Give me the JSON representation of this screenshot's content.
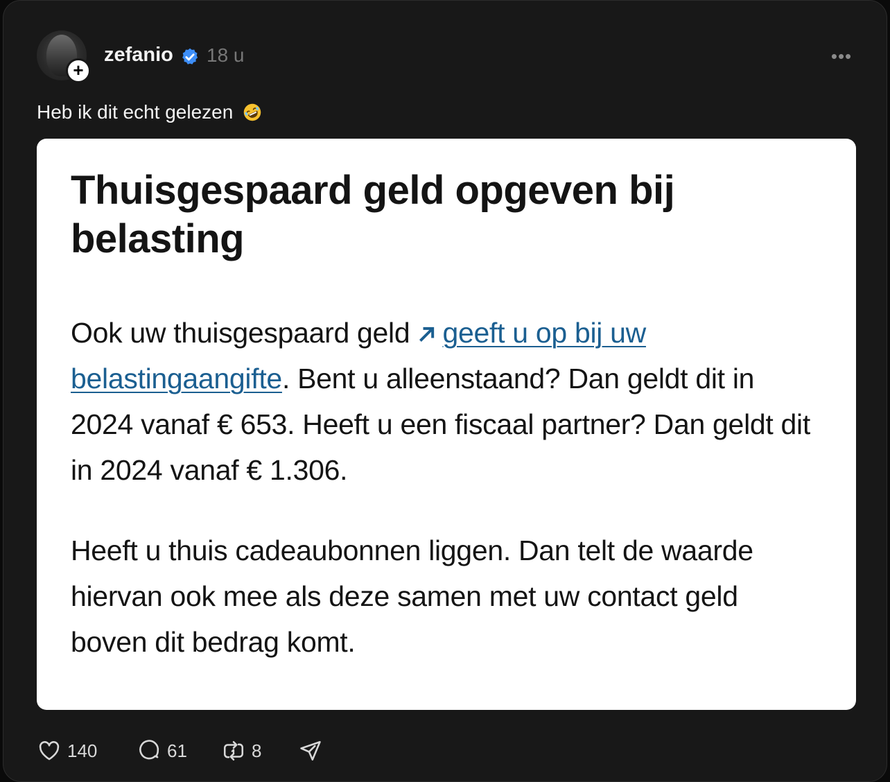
{
  "post": {
    "username": "zefanio",
    "timestamp": "18 u",
    "follow_label": "+",
    "more_label": "•••",
    "caption": "Heb ik dit echt gelezen",
    "caption_emoji": "rolling-on-the-floor-laughing-emoji"
  },
  "article": {
    "headline": "Thuisgespaard geld opgeven bij belasting",
    "p1_before_link": "Ook uw thuisgespaard geld ",
    "p1_link": "geeft u op bij uw belastingaangifte",
    "p1_after_link": ". Bent u alleenstaand? Dan geldt dit in 2024 vanaf € 653. Heeft u een fiscaal partner? Dan geldt dit in 2024 vanaf € 1.306.",
    "p2": "Heeft u thuis cadeaubonnen liggen. Dan telt de waarde hiervan ook mee als deze samen met uw contact geld boven dit bedrag komt."
  },
  "actions": {
    "likes": "140",
    "replies": "61",
    "reposts": "8"
  },
  "colors": {
    "background": "#181818",
    "text_primary": "#f3f3f3",
    "text_muted": "#777777",
    "verified_blue": "#3d8ef7",
    "link_blue": "#1b5f91"
  },
  "icons": {
    "verified": "verified-badge-icon",
    "more": "more-horizontal-icon",
    "like": "heart-icon",
    "reply": "speech-bubble-icon",
    "repost": "repost-icon",
    "share": "send-icon",
    "external_link": "external-arrow-icon"
  }
}
